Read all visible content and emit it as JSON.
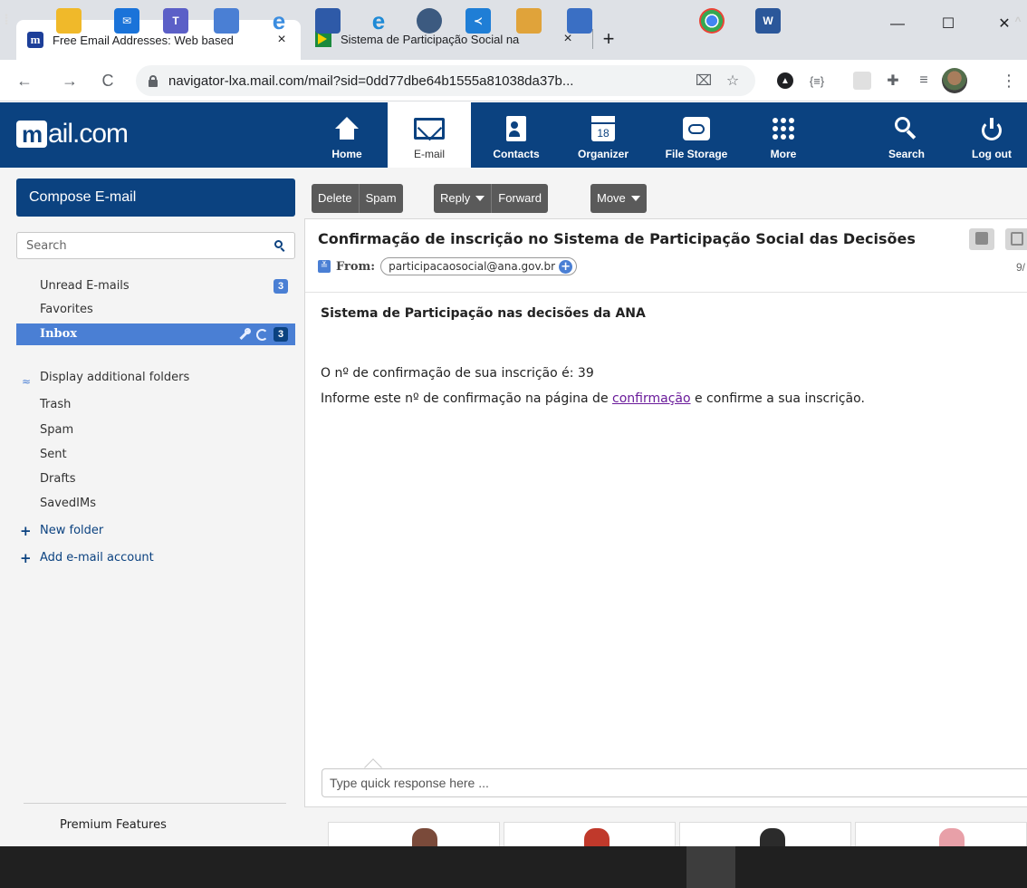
{
  "browser": {
    "tabs": [
      {
        "title": "Free Email Addresses: Web based",
        "close": "×"
      },
      {
        "title": "Sistema de Participação Social na",
        "close": "×"
      }
    ],
    "new_tab": "+",
    "window": {
      "minimize": "—",
      "maximize": "☐",
      "close": "✕"
    },
    "nav": {
      "back": "←",
      "forward": "→",
      "reload": "C"
    },
    "url": "navigator-lxa.mail.com/mail?sid=0dd77dbe64b1555a81038da37b...",
    "ext_json": "{≡}",
    "menu": "⋮"
  },
  "header": {
    "logo_m": "m",
    "logo_text": "ail.com",
    "nav": [
      {
        "label": "Home",
        "icon": "home-icon"
      },
      {
        "label": "E-mail",
        "icon": "envelope-icon",
        "active": true
      },
      {
        "label": "Contacts",
        "icon": "contacts-icon"
      },
      {
        "label": "Organizer",
        "icon": "calendar-icon",
        "calendar_day": "18"
      },
      {
        "label": "File Storage",
        "icon": "cloud-folder-icon"
      },
      {
        "label": "More",
        "icon": "grid-icon"
      },
      {
        "label": "Search",
        "icon": "search-icon"
      },
      {
        "label": "Log out",
        "icon": "power-icon"
      }
    ]
  },
  "sidebar": {
    "compose_label": "Compose E-mail",
    "search_placeholder": "Search",
    "unread": {
      "label": "Unread E-mails",
      "count": "3"
    },
    "favorites": "Favorites",
    "inbox": {
      "label": "Inbox",
      "count": "3"
    },
    "additional_folders_label": "Display additional folders",
    "folders": [
      "Trash",
      "Spam",
      "Sent",
      "Drafts",
      "SavedIMs"
    ],
    "new_folder": "New folder",
    "add_account": "Add e-mail account",
    "premium": "Premium Features"
  },
  "toolbar": {
    "delete": "Delete",
    "spam": "Spam",
    "reply": "Reply",
    "forward": "Forward",
    "move": "Move"
  },
  "message": {
    "subject": "Confirmação de inscrição no Sistema de Participação Social das Decisões",
    "from_label": "From:",
    "from_address": "participacaosocial@ana.gov.br",
    "date": "9/",
    "body_heading": "Sistema de Participação nas decisões da ANA",
    "line1": "O nº de confirmação de sua inscrição é: 39",
    "line2_before": "Informe este nº de confirmação na página de ",
    "line2_link": "confirmação",
    "line2_after": " e confirme a sua inscrição.",
    "quick_response_placeholder": "Type quick response here ..."
  },
  "colors": {
    "brand": "#0b4280",
    "inbox_highlight": "#4a7fd4",
    "toolbar_button": "#5a5a5a",
    "link": "#6a1b9a"
  }
}
